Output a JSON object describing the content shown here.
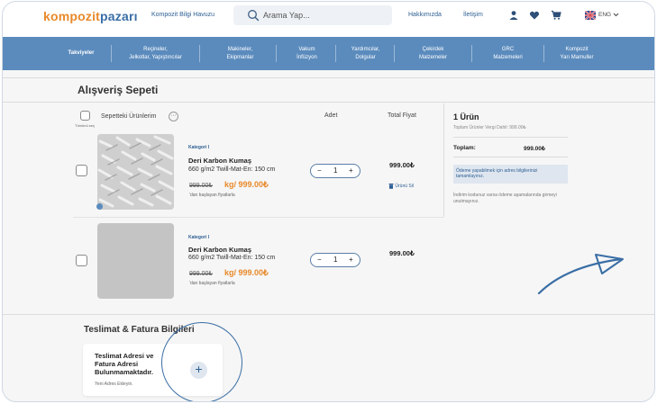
{
  "header": {
    "logo_part1": "kompozit",
    "logo_part2": "pazarı",
    "knowledge_link": "Kompozit Bilgi Havuzu",
    "search_placeholder": "Arama Yap...",
    "about_link": "Hakkımızda",
    "contact_link": "İletişim",
    "language": "ENG",
    "icons": [
      "user-icon",
      "heart-icon",
      "cart-icon",
      "uk-flag-icon",
      "chevron-down-icon",
      "search-icon"
    ]
  },
  "nav": {
    "items": [
      {
        "line1": "Takviyeler",
        "line2": ""
      },
      {
        "line1": "Reçineler,",
        "line2": "Jelkotlar, Yapıştırıcılar"
      },
      {
        "line1": "Makineler,",
        "line2": "Ekipmanlar"
      },
      {
        "line1": "Vakum",
        "line2": "İnfüzyon"
      },
      {
        "line1": "Yardımcılar,",
        "line2": "Dolgular"
      },
      {
        "line1": "Çekirdek",
        "line2": "Malzemeler"
      },
      {
        "line1": "GRC",
        "line2": "Malzemeleri"
      },
      {
        "line1": "Kompozit",
        "line2": "Yarı Mamuller"
      }
    ]
  },
  "cart": {
    "title": "Alışveriş Sepeti",
    "select_all_label": "Tümünü seç",
    "products_header": "Sepetteki Ürünlerim",
    "qty_header": "Adet",
    "total_header": "Total Fiyat",
    "items": [
      {
        "category": "Kategori I",
        "name": "Deri Karbon Kumaş",
        "desc": "660 g/m2 Twill-Mat-En: 150 cm",
        "old_price": "999.00₺",
        "price_prefix": "kg/",
        "new_price": "999.00₺",
        "note": "'dan başlayan fiyatlarla",
        "qty": "1",
        "total": "999.00₺",
        "remove_label": "Ürünü Sil"
      },
      {
        "category": "Kategori I",
        "name": "Deri Karbon Kumaş",
        "desc": "660 g/m2 Twill-Mat-En: 150 cm",
        "old_price": "999.00₺",
        "price_prefix": "kg/",
        "new_price": "999.00₺",
        "note": "'dan başlayan fiyatlarla",
        "qty": "1",
        "total": "999.00₺"
      }
    ]
  },
  "summary": {
    "count": "1 Ürün",
    "sub": "Toplam Ürünler Vergi Dahil: 999.00₺",
    "total_label": "Toplam:",
    "total_value": "999.00₺",
    "info": "Ödeme yapabilmek için adres bilgilerinizi tamamlayınız.",
    "note": "İndirim kodunuz varsa ödeme aşamalarında girmeyi unutmayınız."
  },
  "shipping": {
    "title": "Teslimat & Fatura Bilgileri",
    "empty_msg": "Teslimat Adresi ve Fatura Adresi Bulunmamaktadır.",
    "add_label": "Yeni Adres Ekleyin."
  },
  "colors": {
    "brand_orange": "#e8892a",
    "brand_blue": "#3a6ea5",
    "nav_bg": "#5b8bbd"
  }
}
